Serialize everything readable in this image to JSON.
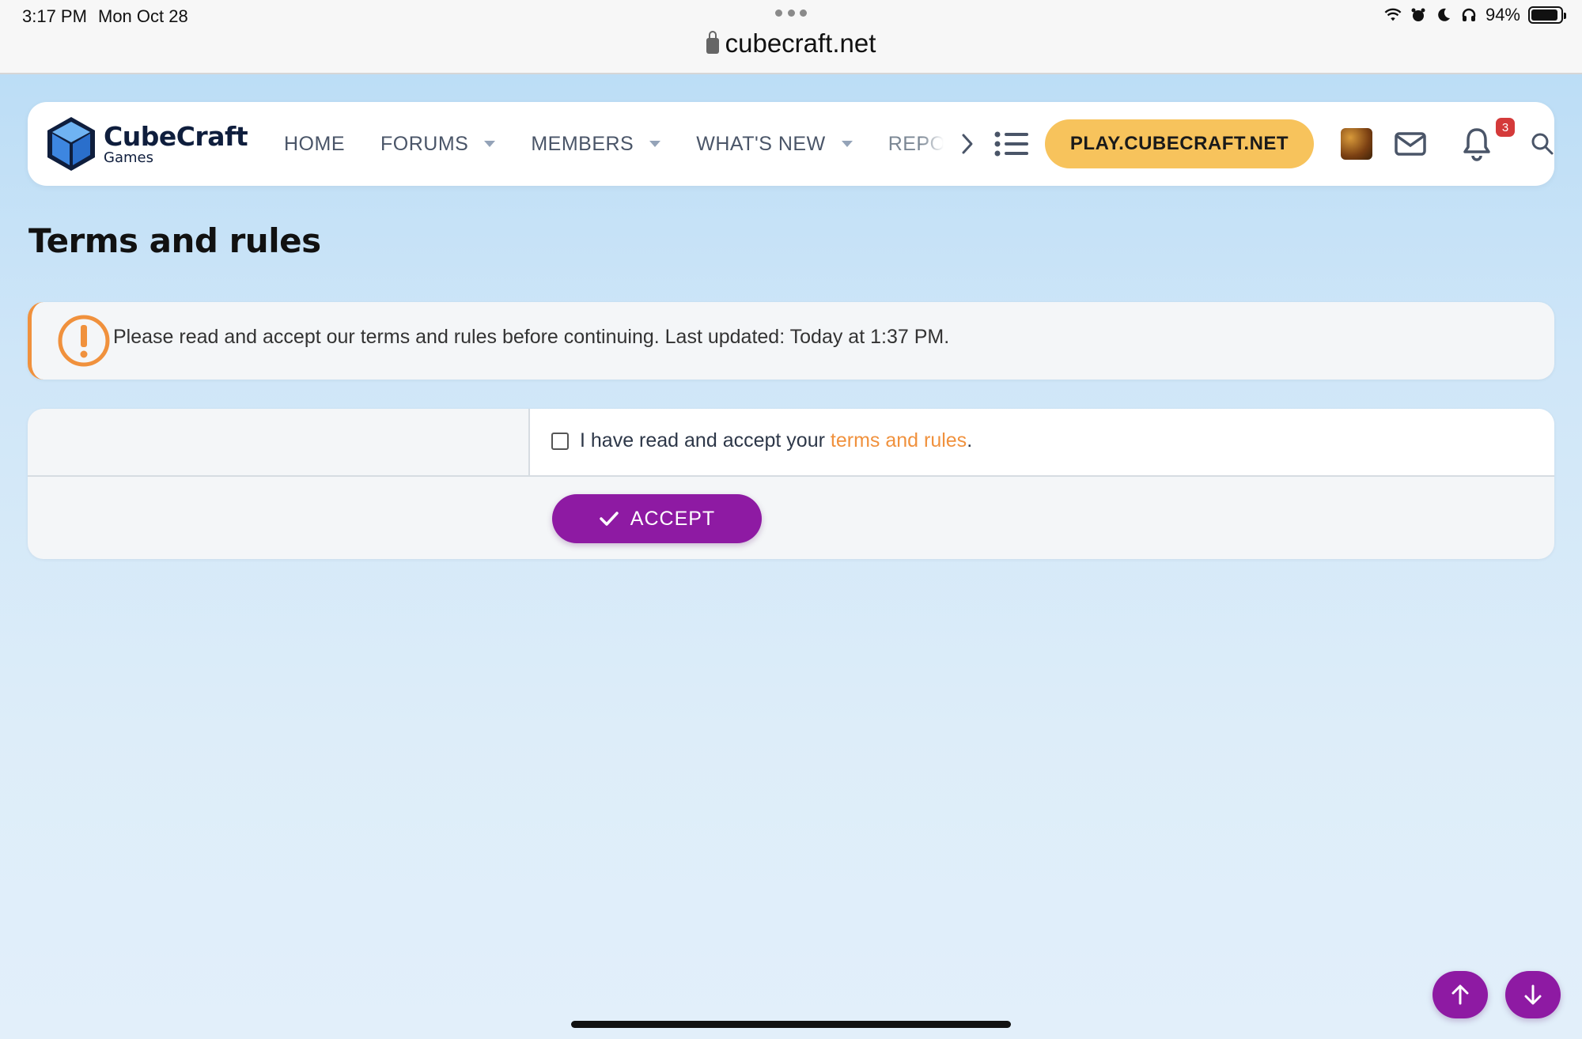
{
  "status_bar": {
    "time": "3:17 PM",
    "date": "Mon Oct 28",
    "battery": "94%",
    "icons": [
      "wifi-icon",
      "alarm-icon",
      "moon-icon",
      "headphones-icon",
      "battery-icon"
    ]
  },
  "browser": {
    "url": "cubecraft.net"
  },
  "header": {
    "logo_title": "CubeCraft",
    "logo_subtitle": "Games",
    "nav": [
      {
        "label": "HOME"
      },
      {
        "label": "FORUMS"
      },
      {
        "label": "MEMBERS"
      },
      {
        "label": "WHAT'S NEW"
      },
      {
        "label": "REPO"
      }
    ],
    "play_button": "PLAY.CUBECRAFT.NET",
    "notification_count": "3"
  },
  "page": {
    "title": "Terms and rules",
    "notice": "Please read and accept our terms and rules before continuing. Last updated: Today at 1:37 PM.",
    "checkbox_text": "I have read and accept your",
    "checkbox_link": "terms and rules",
    "checkbox_period": ".",
    "accept_label": "ACCEPT"
  },
  "colors": {
    "accent_purple": "#8e1aa3",
    "play_yellow": "#f7c35c",
    "notice_orange": "#f0913d",
    "badge_red": "#d43a3a"
  }
}
